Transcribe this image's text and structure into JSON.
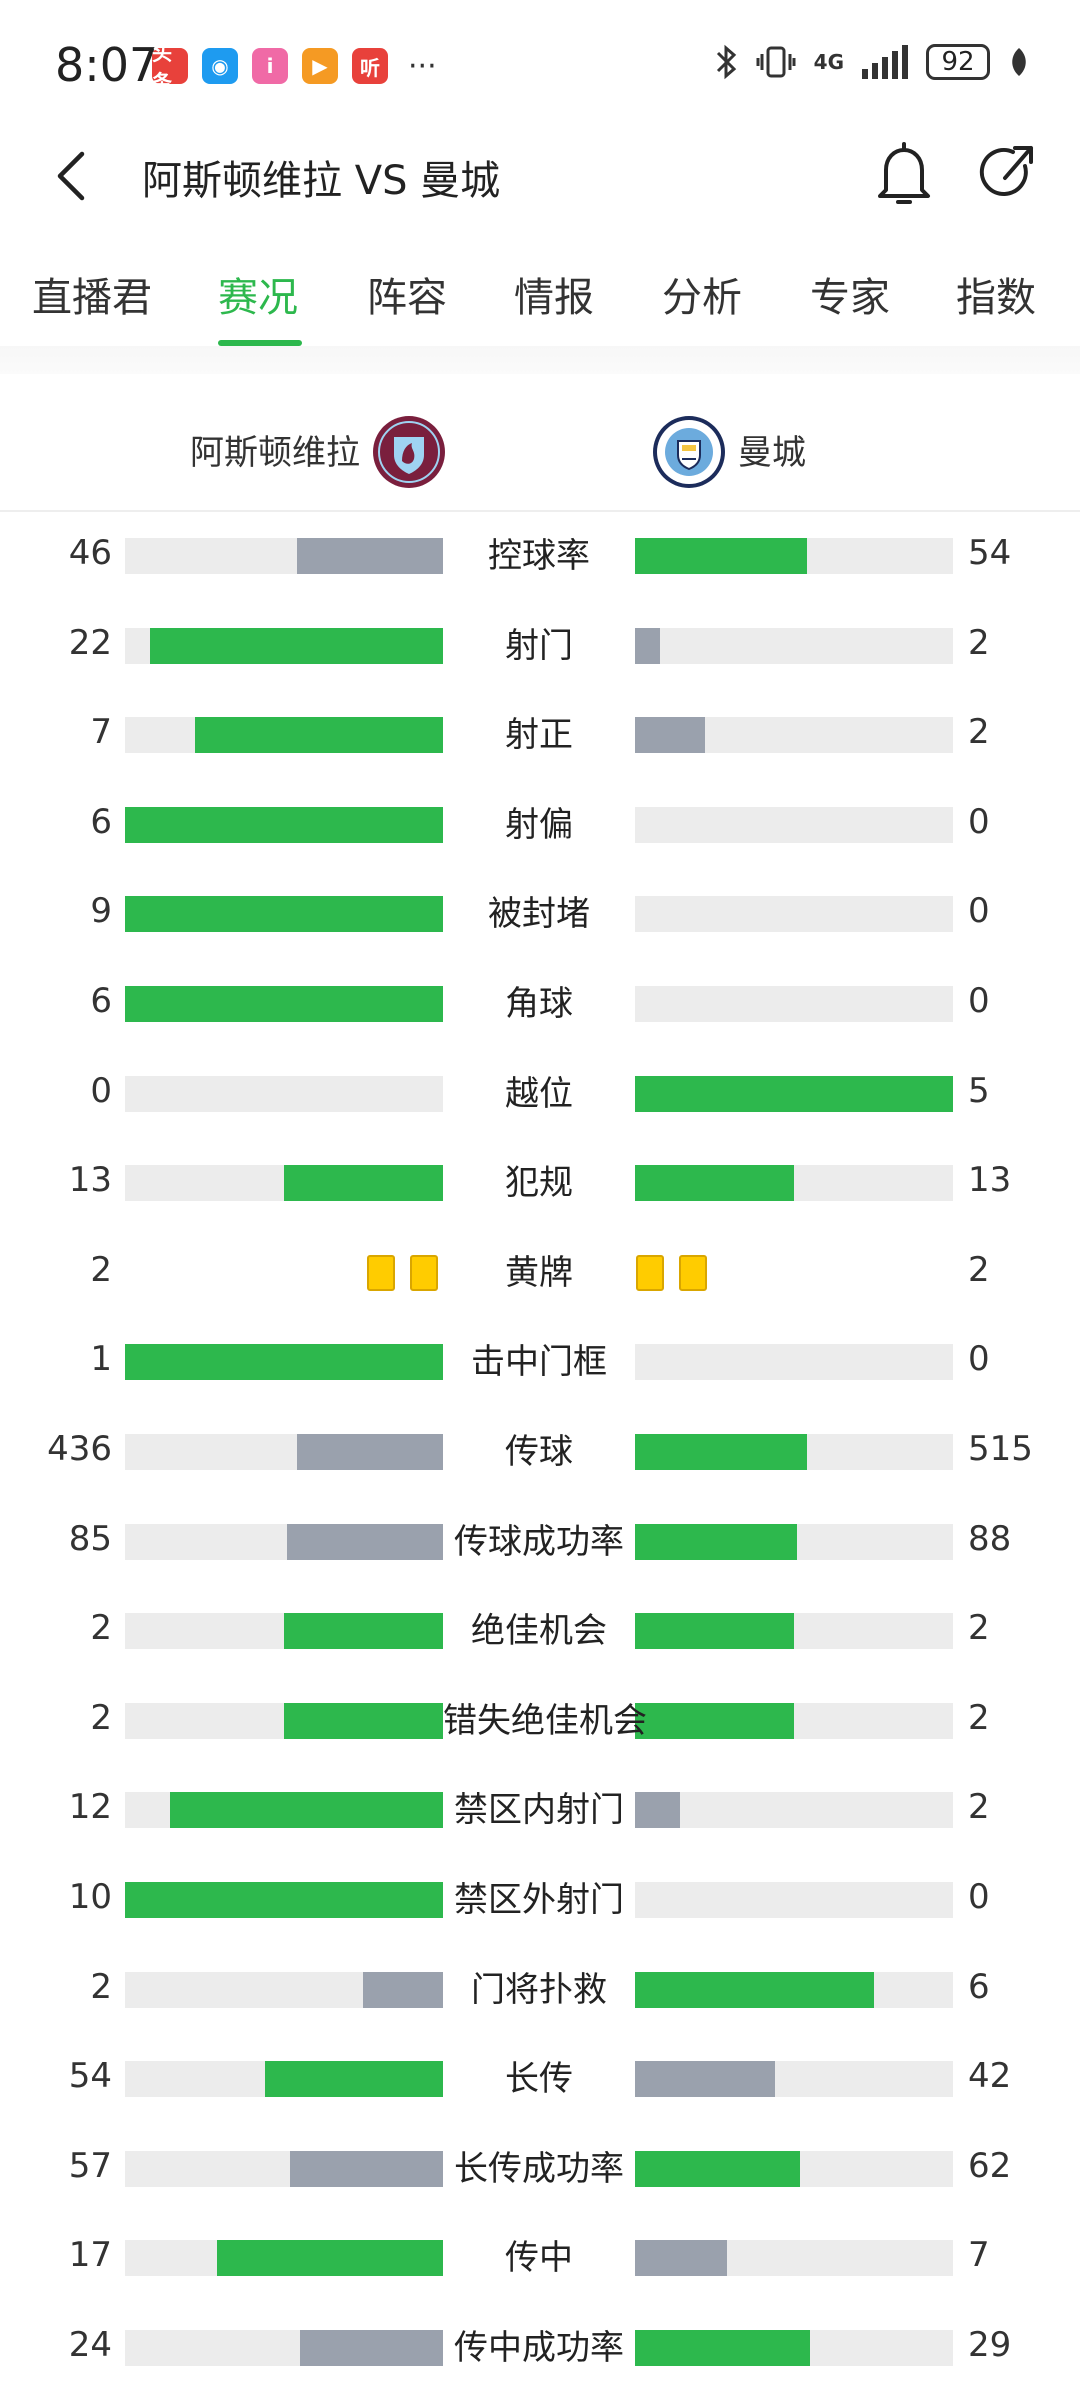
{
  "status_bar": {
    "time": "8:07",
    "apps": [
      {
        "icon": "toutiao-icon",
        "text": "头条",
        "color": "#e8413b"
      },
      {
        "icon": "browser-icon",
        "text": "◉",
        "color": "#1e9bf0"
      },
      {
        "icon": "i-app-icon",
        "text": "i",
        "color": "#f06aa6"
      },
      {
        "icon": "video-icon",
        "text": "▶",
        "color": "#f59a23"
      },
      {
        "icon": "listen-icon",
        "text": "听",
        "color": "#e8413b"
      }
    ],
    "more": "···",
    "network": "4G",
    "battery": "92"
  },
  "header": {
    "title": "阿斯顿维拉 VS 曼城"
  },
  "tabs": [
    {
      "label": "直播君",
      "active": false
    },
    {
      "label": "赛况",
      "active": true
    },
    {
      "label": "阵容",
      "active": false
    },
    {
      "label": "情报",
      "active": false
    },
    {
      "label": "分析",
      "active": false
    },
    {
      "label": "专家",
      "active": false
    },
    {
      "label": "指数",
      "active": false
    }
  ],
  "teams": {
    "home": "阿斯顿维拉",
    "away": "曼城"
  },
  "colors": {
    "leader": "#2db84d",
    "trailer": "#9aa1ad",
    "track": "#ececec",
    "accent": "#2db84d"
  },
  "stats": [
    {
      "label": "控球率",
      "home": "46",
      "away": "54",
      "home_ratio": 0.46,
      "away_ratio": 0.54,
      "home_lead": false,
      "away_lead": true
    },
    {
      "label": "射门",
      "home": "22",
      "away": "2",
      "home_ratio": 0.92,
      "away_ratio": 0.08,
      "home_lead": true,
      "away_lead": false
    },
    {
      "label": "射正",
      "home": "7",
      "away": "2",
      "home_ratio": 0.78,
      "away_ratio": 0.22,
      "home_lead": true,
      "away_lead": false
    },
    {
      "label": "射偏",
      "home": "6",
      "away": "0",
      "home_ratio": 1.0,
      "away_ratio": 0.0,
      "home_lead": true,
      "away_lead": false
    },
    {
      "label": "被封堵",
      "home": "9",
      "away": "0",
      "home_ratio": 1.0,
      "away_ratio": 0.0,
      "home_lead": true,
      "away_lead": false
    },
    {
      "label": "角球",
      "home": "6",
      "away": "0",
      "home_ratio": 1.0,
      "away_ratio": 0.0,
      "home_lead": true,
      "away_lead": false
    },
    {
      "label": "越位",
      "home": "0",
      "away": "5",
      "home_ratio": 0.0,
      "away_ratio": 1.0,
      "home_lead": false,
      "away_lead": true
    },
    {
      "label": "犯规",
      "home": "13",
      "away": "13",
      "home_ratio": 0.5,
      "away_ratio": 0.5,
      "home_lead": true,
      "away_lead": true
    },
    {
      "label": "黄牌",
      "home": "2",
      "away": "2",
      "cards": true
    },
    {
      "label": "击中门框",
      "home": "1",
      "away": "0",
      "home_ratio": 1.0,
      "away_ratio": 0.0,
      "home_lead": true,
      "away_lead": false
    },
    {
      "label": "传球",
      "home": "436",
      "away": "515",
      "home_ratio": 0.46,
      "away_ratio": 0.54,
      "home_lead": false,
      "away_lead": true
    },
    {
      "label": "传球成功率",
      "home": "85",
      "away": "88",
      "home_ratio": 0.49,
      "away_ratio": 0.51,
      "home_lead": false,
      "away_lead": true
    },
    {
      "label": "绝佳机会",
      "home": "2",
      "away": "2",
      "home_ratio": 0.5,
      "away_ratio": 0.5,
      "home_lead": true,
      "away_lead": true
    },
    {
      "label": "错失绝佳机会",
      "home": "2",
      "away": "2",
      "home_ratio": 0.5,
      "away_ratio": 0.5,
      "home_lead": true,
      "away_lead": true
    },
    {
      "label": "禁区内射门",
      "home": "12",
      "away": "2",
      "home_ratio": 0.86,
      "away_ratio": 0.14,
      "home_lead": true,
      "away_lead": false
    },
    {
      "label": "禁区外射门",
      "home": "10",
      "away": "0",
      "home_ratio": 1.0,
      "away_ratio": 0.0,
      "home_lead": true,
      "away_lead": false
    },
    {
      "label": "门将扑救",
      "home": "2",
      "away": "6",
      "home_ratio": 0.25,
      "away_ratio": 0.75,
      "home_lead": false,
      "away_lead": true
    },
    {
      "label": "长传",
      "home": "54",
      "away": "42",
      "home_ratio": 0.56,
      "away_ratio": 0.44,
      "home_lead": true,
      "away_lead": false
    },
    {
      "label": "长传成功率",
      "home": "57",
      "away": "62",
      "home_ratio": 0.48,
      "away_ratio": 0.52,
      "home_lead": false,
      "away_lead": true
    },
    {
      "label": "传中",
      "home": "17",
      "away": "7",
      "home_ratio": 0.71,
      "away_ratio": 0.29,
      "home_lead": true,
      "away_lead": false
    },
    {
      "label": "传中成功率",
      "home": "24",
      "away": "29",
      "home_ratio": 0.45,
      "away_ratio": 0.55,
      "home_lead": false,
      "away_lead": true
    }
  ]
}
